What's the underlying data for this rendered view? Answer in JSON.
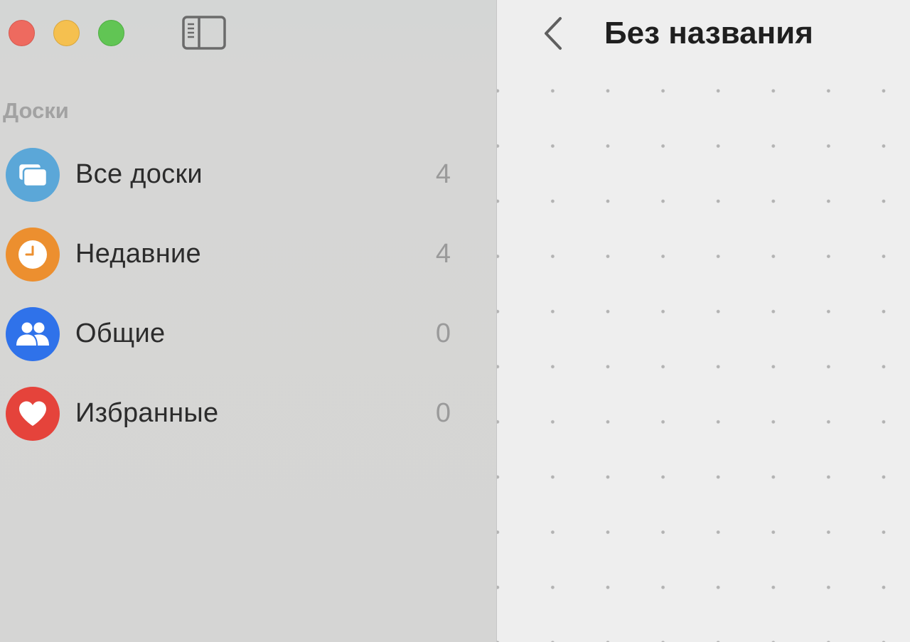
{
  "window": {
    "controls": {
      "close": "close-button",
      "minimize": "minimize-button",
      "maximize": "maximize-button"
    },
    "sidebar_toggle_icon": "sidebar-toggle-icon"
  },
  "sidebar": {
    "section_title": "Доски",
    "items": [
      {
        "label": "Все доски",
        "count": "4",
        "icon": "boards-icon",
        "color": "#5ba7d8"
      },
      {
        "label": "Недавние",
        "count": "4",
        "icon": "clock-icon",
        "color": "#ec8f2f"
      },
      {
        "label": "Общие",
        "count": "0",
        "icon": "people-icon",
        "color": "#2f72ea"
      },
      {
        "label": "Избранные",
        "count": "0",
        "icon": "heart-icon",
        "color": "#e5433b"
      }
    ]
  },
  "main": {
    "back_icon": "chevron-left-icon",
    "title": "Без названия"
  },
  "colors": {
    "sidebar_background": "#d5d5d4",
    "canvas_background": "#eeeeee",
    "canvas_dot": "#b3b3b3"
  }
}
